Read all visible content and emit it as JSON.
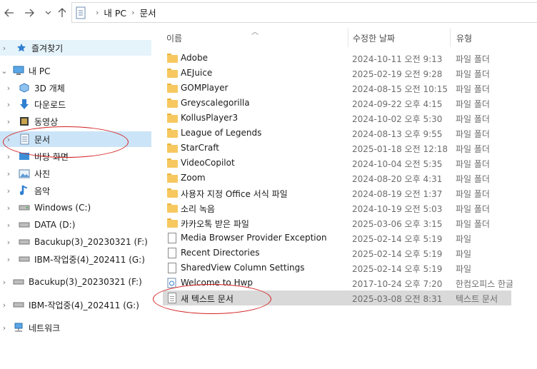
{
  "address": {
    "crumbs": [
      "내 PC",
      "문서"
    ]
  },
  "nav": {
    "items": [
      {
        "label": "즐겨찾기",
        "icon": "star-icon"
      },
      {
        "label": "내 PC",
        "icon": "computer-icon"
      },
      {
        "label": "3D 개체",
        "icon": "cube-icon"
      },
      {
        "label": "다운로드",
        "icon": "download-arrow-icon"
      },
      {
        "label": "동영상",
        "icon": "video-icon"
      },
      {
        "label": "문서",
        "icon": "document-icon"
      },
      {
        "label": "바탕 화면",
        "icon": "desktop-icon"
      },
      {
        "label": "사진",
        "icon": "picture-icon"
      },
      {
        "label": "음악",
        "icon": "music-note-icon"
      },
      {
        "label": "Windows (C:)",
        "icon": "drive-icon"
      },
      {
        "label": "DATA (D:)",
        "icon": "drive-icon"
      },
      {
        "label": "Bacukup(3)_20230321 (F:)",
        "icon": "drive-icon"
      },
      {
        "label": "IBM-작업중(4)_202411 (G:)",
        "icon": "drive-icon"
      },
      {
        "label": "Bacukup(3)_20230321 (F:)",
        "icon": "drive-icon"
      },
      {
        "label": "IBM-작업중(4)_202411 (G:)",
        "icon": "drive-icon"
      },
      {
        "label": "네트워크",
        "icon": "network-icon"
      }
    ]
  },
  "columns": {
    "name": "이름",
    "date": "수정한 날짜",
    "type": "유형"
  },
  "files": [
    {
      "name": "Adobe",
      "date": "2024-10-11 오전 9:13",
      "type": "파일 폴더",
      "kind": "folder"
    },
    {
      "name": "AEJuice",
      "date": "2025-02-19 오전 9:28",
      "type": "파일 폴더",
      "kind": "folder"
    },
    {
      "name": "GOMPlayer",
      "date": "2024-08-15 오전 10:15",
      "type": "파일 폴더",
      "kind": "folder"
    },
    {
      "name": "Greyscalegorilla",
      "date": "2024-09-22 오후 4:15",
      "type": "파일 폴더",
      "kind": "folder"
    },
    {
      "name": "KollusPlayer3",
      "date": "2024-10-02 오후 5:30",
      "type": "파일 폴더",
      "kind": "folder"
    },
    {
      "name": "League of Legends",
      "date": "2024-08-13 오후 9:55",
      "type": "파일 폴더",
      "kind": "folder"
    },
    {
      "name": "StarCraft",
      "date": "2025-01-18 오전 12:18",
      "type": "파일 폴더",
      "kind": "folder"
    },
    {
      "name": "VideoCopilot",
      "date": "2024-10-04 오전 5:35",
      "type": "파일 폴더",
      "kind": "folder"
    },
    {
      "name": "Zoom",
      "date": "2024-08-20 오후 4:31",
      "type": "파일 폴더",
      "kind": "folder"
    },
    {
      "name": "사용자 지정 Office 서식 파일",
      "date": "2024-08-19 오전 1:37",
      "type": "파일 폴더",
      "kind": "folder"
    },
    {
      "name": "소리 녹음",
      "date": "2024-10-19 오전 5:03",
      "type": "파일 폴더",
      "kind": "folder"
    },
    {
      "name": "카카오톡 받은 파일",
      "date": "2025-03-06 오후 3:15",
      "type": "파일 폴더",
      "kind": "folder"
    },
    {
      "name": "Media Browser Provider Exception",
      "date": "2025-02-14 오후 5:19",
      "type": "파일",
      "kind": "file"
    },
    {
      "name": "Recent Directories",
      "date": "2025-02-14 오후 5:19",
      "type": "파일",
      "kind": "file"
    },
    {
      "name": "SharedView Column Settings",
      "date": "2025-02-14 오후 5:19",
      "type": "파일",
      "kind": "file"
    },
    {
      "name": "Welcome to Hwp",
      "date": "2017-10-24 오후 7:20",
      "type": "한컴오피스 한글",
      "kind": "hwp"
    },
    {
      "name": "새 텍스트 문서",
      "date": "2025-03-08 오전 8:31",
      "type": "텍스트 문서",
      "kind": "text"
    }
  ],
  "colors": {
    "selected": "#cce4f7",
    "annotation": "#d42020",
    "folder": "#f6c85f"
  }
}
